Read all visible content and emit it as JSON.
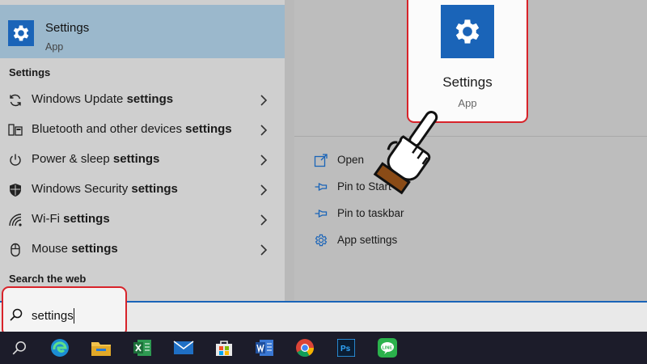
{
  "best_match": {
    "title": "Settings",
    "subtitle": "App",
    "icon": "gear-icon"
  },
  "sections": {
    "settings_label": "Settings",
    "web_label": "Search the web"
  },
  "results": [
    {
      "prefix": "Windows Update ",
      "bold": "settings",
      "icon": "sync-icon"
    },
    {
      "prefix": "Bluetooth and other devices ",
      "bold": "settings",
      "icon": "devices-icon"
    },
    {
      "prefix": "Power & sleep ",
      "bold": "settings",
      "icon": "power-icon"
    },
    {
      "prefix": "Windows Security ",
      "bold": "settings",
      "icon": "shield-icon"
    },
    {
      "prefix": "Wi-Fi ",
      "bold": "settings",
      "icon": "wifi-icon"
    },
    {
      "prefix": "Mouse ",
      "bold": "settings",
      "icon": "mouse-icon"
    }
  ],
  "preview": {
    "title": "Settings",
    "subtitle": "App",
    "actions": [
      {
        "label": "Open",
        "icon": "open-icon"
      },
      {
        "label": "Pin to Start",
        "icon": "pin-icon"
      },
      {
        "label": "Pin to taskbar",
        "icon": "pin-icon"
      },
      {
        "label": "App settings",
        "icon": "gear-icon"
      }
    ]
  },
  "search": {
    "query": "settings"
  },
  "taskbar": {
    "icons": [
      "search-icon",
      "edge-icon",
      "file-explorer-icon",
      "excel-icon",
      "mail-icon",
      "store-icon",
      "word-icon",
      "chrome-icon",
      "photoshop-icon",
      "line-icon"
    ]
  },
  "colors": {
    "accent": "#1a64b8",
    "highlight": "#d8232a",
    "taskbar": "#1c1c2a"
  }
}
